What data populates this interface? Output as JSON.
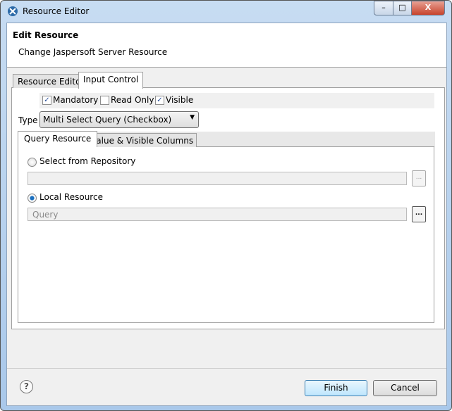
{
  "window": {
    "title": "Resource Editor",
    "minimize": "–",
    "maximize": "□",
    "close": "X"
  },
  "header": {
    "title": "Edit Resource",
    "subtitle": "Change Jaspersoft Server Resource"
  },
  "tabs": [
    {
      "label": "Resource Editor",
      "selected": false
    },
    {
      "label": "Input Control",
      "selected": true
    }
  ],
  "checkboxes": [
    {
      "label": "Mandatory",
      "checked": true
    },
    {
      "label": "Read Only",
      "checked": false
    },
    {
      "label": "Visible",
      "checked": true
    }
  ],
  "type": {
    "label": "Type",
    "value": "Multi Select Query (Checkbox)"
  },
  "inner_tabs": [
    {
      "label": "Query Resource",
      "selected": true
    },
    {
      "label": "Value & Visible Columns",
      "selected": false
    }
  ],
  "source": {
    "repository_label": "Select from Repository",
    "repository_selected": false,
    "repository_value": "",
    "local_label": "Local Resource",
    "local_selected": true,
    "local_value": "Query",
    "browse": "..."
  },
  "footer": {
    "help": "?",
    "finish": "Finish",
    "cancel": "Cancel"
  }
}
